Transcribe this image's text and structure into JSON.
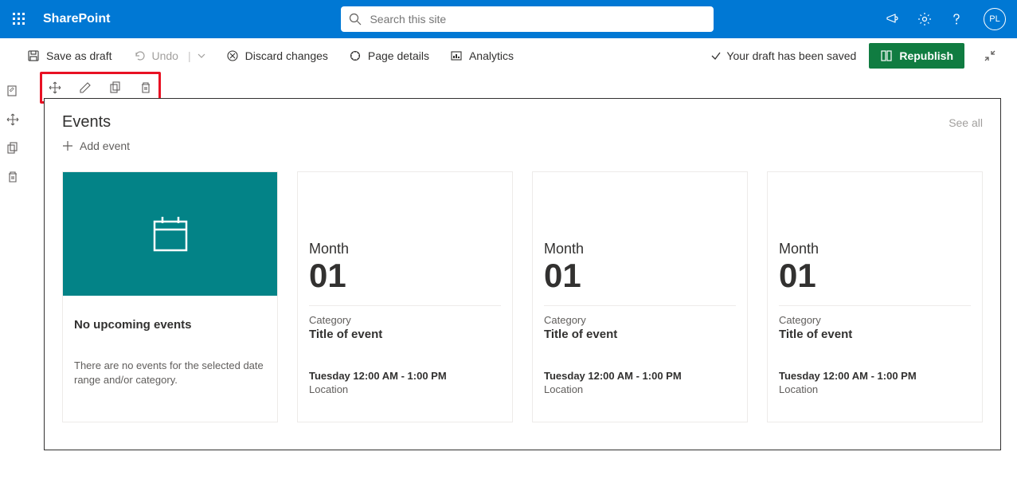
{
  "suite": {
    "brand": "SharePoint",
    "search_placeholder": "Search this site",
    "avatar_initials": "PL"
  },
  "commandbar": {
    "save_draft": "Save as draft",
    "undo": "Undo",
    "discard": "Discard changes",
    "page_details": "Page details",
    "analytics": "Analytics",
    "saved_message": "Your draft has been saved",
    "republish": "Republish"
  },
  "webpart": {
    "title": "Events",
    "see_all": "See all",
    "add_event": "Add event",
    "empty_card": {
      "title": "No upcoming events",
      "description": "There are no events for the selected date range and/or category."
    },
    "placeholder_events": [
      {
        "month": "Month",
        "day": "01",
        "category": "Category",
        "title": "Title of event",
        "time": "Tuesday 12:00 AM - 1:00 PM",
        "location": "Location"
      },
      {
        "month": "Month",
        "day": "01",
        "category": "Category",
        "title": "Title of event",
        "time": "Tuesday 12:00 AM - 1:00 PM",
        "location": "Location"
      },
      {
        "month": "Month",
        "day": "01",
        "category": "Category",
        "title": "Title of event",
        "time": "Tuesday 12:00 AM - 1:00 PM",
        "location": "Location"
      }
    ]
  }
}
